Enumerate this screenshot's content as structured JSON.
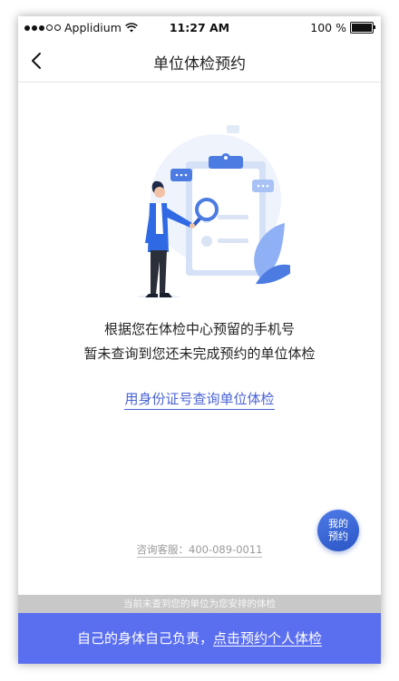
{
  "status_bar": {
    "carrier": "Applidium",
    "time": "11:27 AM",
    "battery": "100 %",
    "signal_filled": 3,
    "signal_total": 5
  },
  "nav": {
    "back_icon": "chevron-left-icon",
    "title": "单位体检预约"
  },
  "message": {
    "line1": "根据您在体检中心预留的手机号",
    "line2": "暂未查询到您还未完成预约的单位体检"
  },
  "id_query_link": "用身份证号查询单位体检",
  "my_booking": {
    "line1": "我的",
    "line2": "预约"
  },
  "hotline": "咨询客服：400-089-0011",
  "notice": "当前未查到您的单位为您安排的体检",
  "cta": {
    "prefix": "自己的身体自己负责，",
    "link": "点击预约个人体检"
  },
  "colors": {
    "accent": "#5a6ef0",
    "link": "#4a63d6",
    "floating_button": "#2a56c6",
    "notice_bg": "#c8c8c8"
  }
}
